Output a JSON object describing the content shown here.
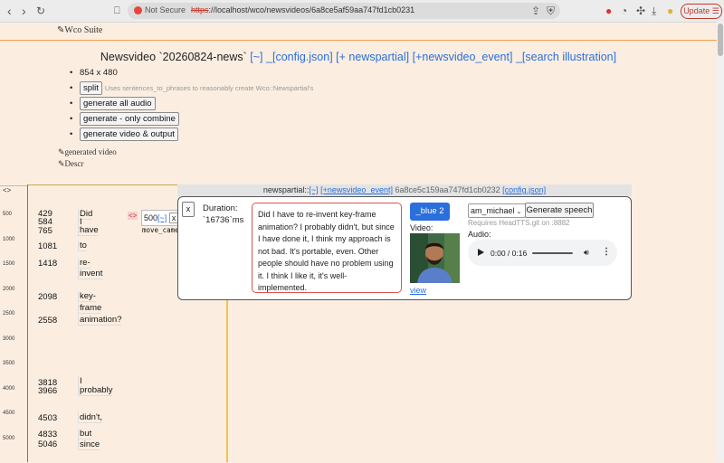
{
  "browser": {
    "not_secure": "Not Secure",
    "url_scheme": "https",
    "url_rest": "://localhost/wco/newsvideos/6a8ce5af59aa747fd1cb0231",
    "update_label": "Update"
  },
  "suite": {
    "title": "Wco Suite"
  },
  "heading": {
    "title": "Newsvideo `20260824-news`",
    "links": [
      "[~]",
      "_[config.json]",
      "[+ newspartial]",
      "[+newsvideo_event]",
      "_[search illustration]"
    ]
  },
  "options": {
    "resolution": "854 x 480",
    "split_label": "split",
    "split_hint": "Uses sentences_to_phrases to reasonably create Wco::Newspartial's",
    "gen_audio": "generate all audio",
    "gen_combine": "generate - only combine",
    "gen_video": "generate video & output"
  },
  "pins": {
    "generated_video": "generated video",
    "descr": "Descr"
  },
  "timeline": {
    "header": "<>",
    "ticks": [
      "500",
      "1000",
      "1500",
      "2000",
      "2500",
      "3000",
      "3500",
      "4000",
      "4500",
      "5000"
    ],
    "ms": [
      "429",
      "584",
      "765",
      "1081",
      "1418",
      "2098",
      "2558",
      "3818",
      "3966",
      "4503",
      "4833",
      "5046"
    ],
    "words": [
      "Did",
      "I",
      "have",
      "to",
      "re-",
      "invent",
      "key-",
      "frame",
      "animation?",
      "I",
      "probably",
      "didn't,",
      "but",
      "since"
    ]
  },
  "row_widget": {
    "arrow": "<>",
    "value": "500",
    "tilde": "[~]",
    "x": "x",
    "name": "move_came"
  },
  "modal": {
    "label": "newspartial::",
    "tilde": "[~]",
    "add_event": "[+newsvideo_event]",
    "id": "6a8ce5c159aa747fd1cb0232",
    "config": "[config.json]",
    "close": "x",
    "duration_label": "Duration:",
    "duration_value": "`16736`ms",
    "phrase": "Did I have to re-invent key-frame animation? I probably didn't, but since I have done it, I think my approach is not bad. It's portable, even. Other people should have no problem using it. I think I like it, it's well-implemented.",
    "voice_button": "_blue 2",
    "video_label": "Video:",
    "view_link": "view",
    "speaker": "am_michael",
    "generate_speech": "Generate speech",
    "requires": "Requires HeadTTS.git on :8882",
    "audio_label": "Audio:",
    "audio_time": "0:00 / 0:16"
  }
}
